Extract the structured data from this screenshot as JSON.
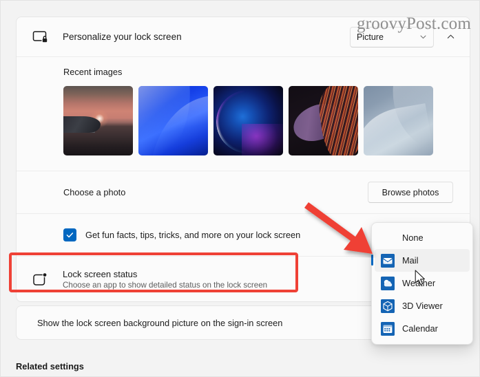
{
  "watermark": "groovyPost.com",
  "header": {
    "icon": "lock-screen-monitor-icon",
    "title": "Personalize your lock screen",
    "personalize_mode": "Picture",
    "chevron_down_icon": "chevron-down-icon",
    "expander_icon": "chevron-up-icon"
  },
  "recent": {
    "label": "Recent images",
    "thumbnails": [
      {
        "name": "sunset-lake-thumbnail",
        "alt": "Sunset over lake"
      },
      {
        "name": "blue-bloom-thumbnail",
        "alt": "Blue abstract bloom"
      },
      {
        "name": "dark-orb-thumbnail",
        "alt": "Dark blue orb with magenta glow"
      },
      {
        "name": "purple-ribbons-thumbnail",
        "alt": "Purple and orange ribbons"
      },
      {
        "name": "blue-fabric-thumbnail",
        "alt": "Light blue draped fabric"
      }
    ]
  },
  "choose_photo": {
    "label": "Choose a photo",
    "browse_button": "Browse photos"
  },
  "fun_facts": {
    "label": "Get fun facts, tips, tricks, and more on your lock screen",
    "checked": true
  },
  "lock_screen_status": {
    "icon": "status-badge-icon",
    "title": "Lock screen status",
    "subtitle": "Choose an app to show detailed status on the lock screen"
  },
  "signin": {
    "label": "Show the lock screen background picture on the sign-in screen"
  },
  "related_settings": {
    "label": "Related settings"
  },
  "flyout": {
    "items": [
      {
        "label": "None",
        "icon": "none",
        "selected": false
      },
      {
        "label": "Mail",
        "icon": "mail-icon",
        "selected": true
      },
      {
        "label": "Weather",
        "icon": "weather-icon",
        "selected": false
      },
      {
        "label": "3D Viewer",
        "icon": "cube-icon",
        "selected": false
      },
      {
        "label": "Calendar",
        "icon": "calendar-icon",
        "selected": false
      }
    ]
  },
  "annotation": {
    "arrow_color": "#ef4136",
    "highlight_color": "#ef4136"
  },
  "colors": {
    "accent": "#0067c0",
    "page_bg": "#f3f3f3",
    "card_bg": "#fbfbfb",
    "text": "#1b1b1b",
    "subtext": "#5d5d5d"
  }
}
